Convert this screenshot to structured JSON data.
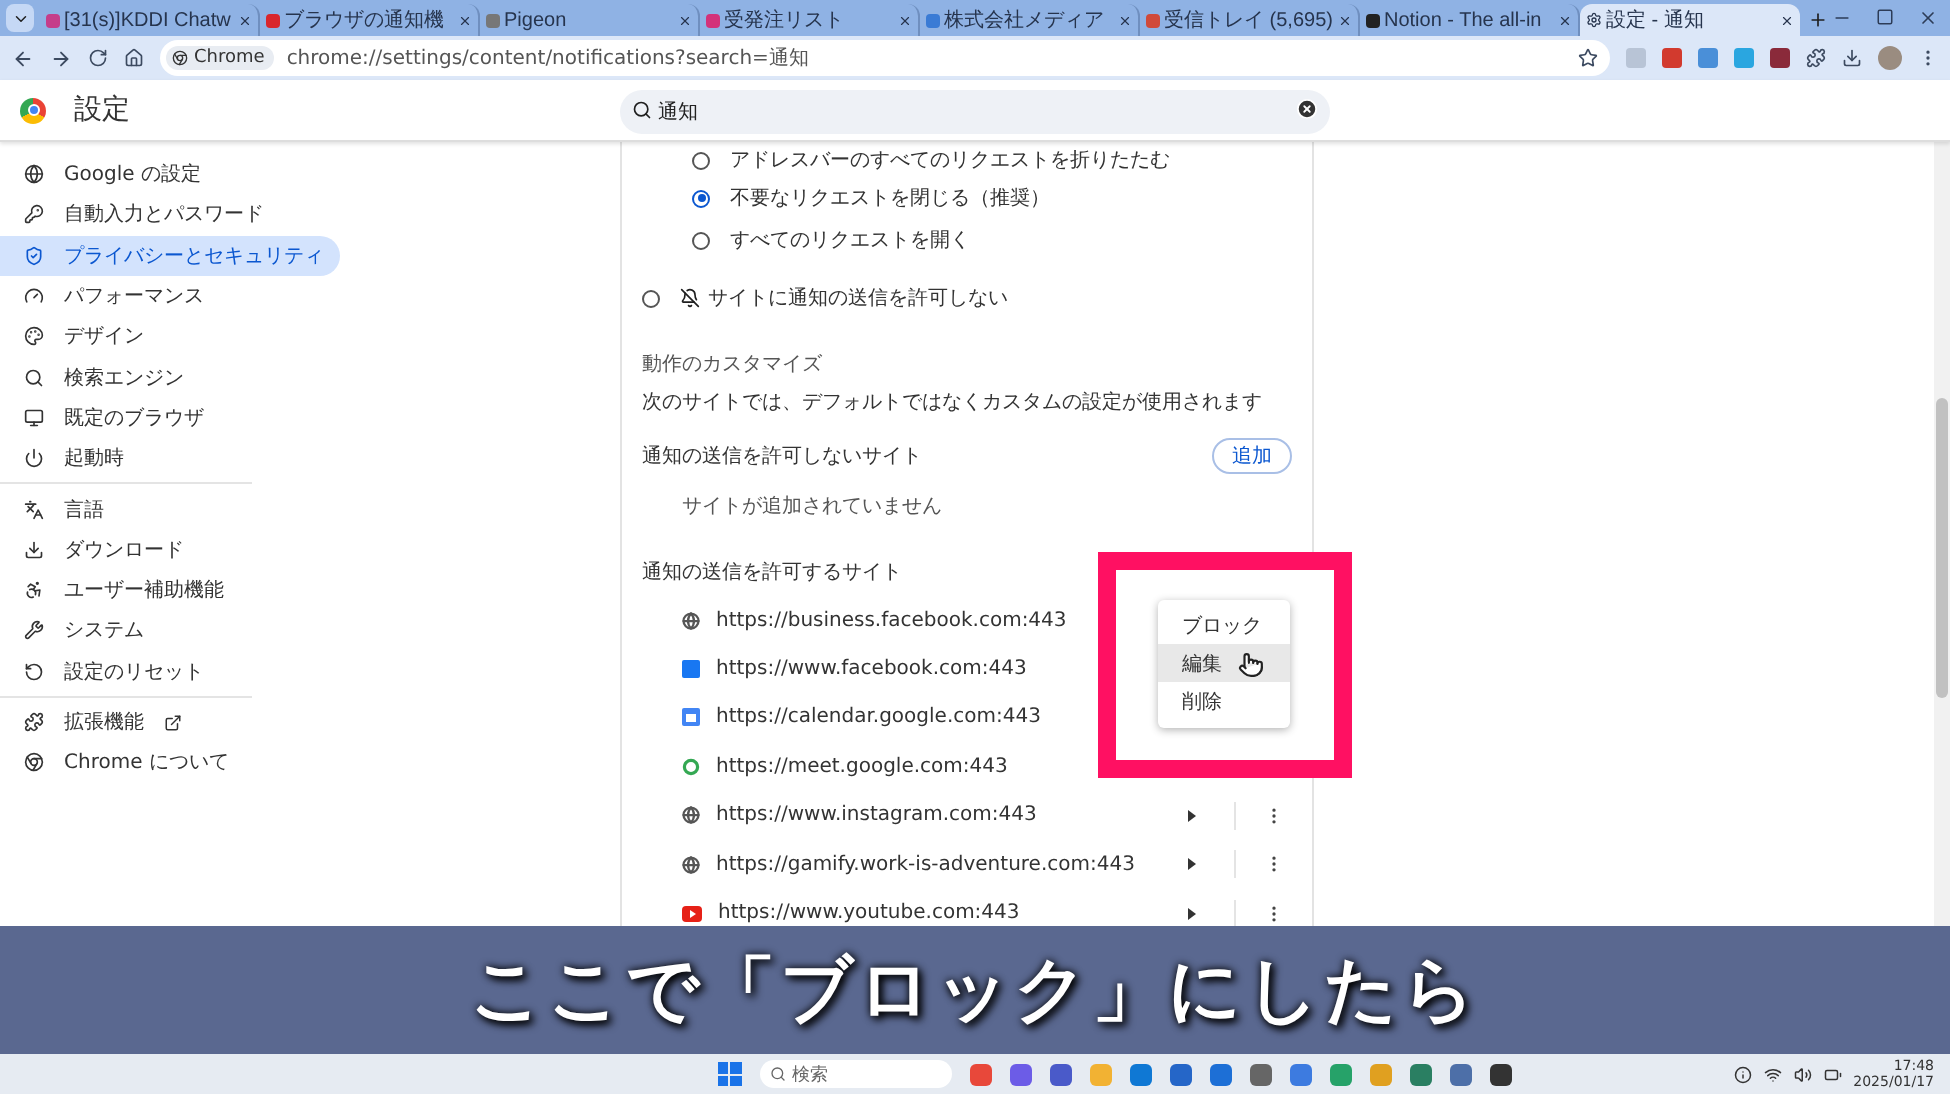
{
  "browser": {
    "tabs": [
      {
        "title": "[31(s)]KDDI Chatw",
        "selected": false
      },
      {
        "title": "ブラウザの通知機",
        "selected": false
      },
      {
        "title": "Pigeon",
        "selected": false
      },
      {
        "title": "受発注リスト",
        "selected": false
      },
      {
        "title": "株式会社メディア",
        "selected": false
      },
      {
        "title": "受信トレイ (5,695)",
        "selected": false
      },
      {
        "title": "Notion - The all-in",
        "selected": false
      },
      {
        "title": "設定 - 通知",
        "selected": true
      }
    ],
    "address": {
      "chip": "Chrome",
      "url": "chrome://settings/content/notifications?search=通知"
    }
  },
  "settings": {
    "title": "設定",
    "search": {
      "value": "通知"
    }
  },
  "sidebar": {
    "groups": [
      {
        "items": [
          {
            "label": "Google の設定",
            "selected": false
          },
          {
            "label": "自動入力とパスワード",
            "selected": false
          },
          {
            "label": "プライバシーとセキュリティ",
            "selected": true
          },
          {
            "label": "パフォーマンス",
            "selected": false
          },
          {
            "label": "デザイン",
            "selected": false
          },
          {
            "label": "検索エンジン",
            "selected": false
          },
          {
            "label": "既定のブラウザ",
            "selected": false
          },
          {
            "label": "起動時",
            "selected": false
          }
        ]
      },
      {
        "items": [
          {
            "label": "言語",
            "selected": false
          },
          {
            "label": "ダウンロード",
            "selected": false
          },
          {
            "label": "ユーザー補助機能",
            "selected": false
          },
          {
            "label": "システム",
            "selected": false
          },
          {
            "label": "設定のリセット",
            "selected": false
          }
        ]
      },
      {
        "items": [
          {
            "label": "拡張機能",
            "selected": false
          },
          {
            "label": "Chrome について",
            "selected": false
          }
        ]
      }
    ]
  },
  "content": {
    "sub_options": [
      {
        "label": "アドレスバーのすべてのリクエストを折りたたむ",
        "selected": false
      },
      {
        "label": "不要なリクエストを閉じる（推奨）",
        "selected": true
      },
      {
        "label": "すべてのリクエストを開く",
        "selected": false
      }
    ],
    "block_option": {
      "label": "サイトに通知の送信を許可しない",
      "selected": false
    },
    "custom_heading": "動作のカスタマイズ",
    "custom_description": "次のサイトでは、デフォルトではなくカスタムの設定が使用されます",
    "blocked": {
      "title": "通知の送信を許可しないサイト",
      "add_button": "追加",
      "empty": "サイトが追加されていません"
    },
    "allowed": {
      "title": "通知の送信を許可するサイト",
      "sites": [
        {
          "url": "https://business.facebook.com:443",
          "actions": false
        },
        {
          "url": "https://www.facebook.com:443",
          "actions": false
        },
        {
          "url": "https://calendar.google.com:443",
          "actions": false
        },
        {
          "url": "https://meet.google.com:443",
          "actions": false
        },
        {
          "url": "https://www.instagram.com:443",
          "actions": true
        },
        {
          "url": "https://gamify.work-is-adventure.com:443",
          "actions": true
        },
        {
          "url": "https://www.youtube.com:443",
          "actions": true
        }
      ]
    }
  },
  "context_menu": {
    "items": [
      {
        "label": "ブロック",
        "highlighted": false
      },
      {
        "label": "編集",
        "highlighted": true
      },
      {
        "label": "削除",
        "highlighted": false
      }
    ]
  },
  "caption": "ここで「ブロック」にしたら",
  "taskbar": {
    "search_placeholder": "検索",
    "time": "17:48",
    "date": "2025/01/17"
  }
}
